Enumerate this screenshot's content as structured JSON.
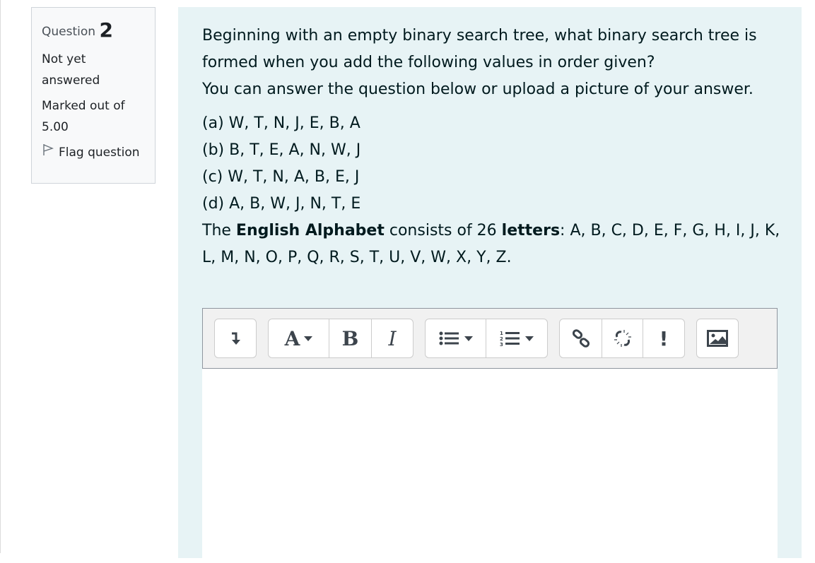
{
  "info": {
    "question_label": "Question",
    "question_number": "2",
    "state": "Not yet answered",
    "grade": "Marked out of 5.00",
    "flag_label": "Flag question"
  },
  "question": {
    "line1": "Beginning with an empty binary search tree, what binary search tree is formed when you add the following values in order given?",
    "line2": "You can answer the question below or upload a picture of your answer.",
    "options": [
      "(a) W, T, N, J, E, B, A",
      "(b) B, T, E, A, N, W, J",
      "(c) W, T, N, A, B, E, J",
      "(d) A, B, W, J, N, T, E"
    ],
    "alpha": {
      "pre": "The ",
      "bold1": "English Alphabet",
      "mid": " consists of 26 ",
      "bold2": "letters",
      "post": ": A, B, C, D, E, F, G, H, I, J, K, L, M, N, O, P, Q, R, S, T, U, V, W, X, Y, Z."
    }
  },
  "editor": {
    "toolbar": {
      "font_style_label": "A",
      "bold_label": "B",
      "italic_label": "I",
      "unlink_exclaim": "!"
    },
    "value": ""
  }
}
